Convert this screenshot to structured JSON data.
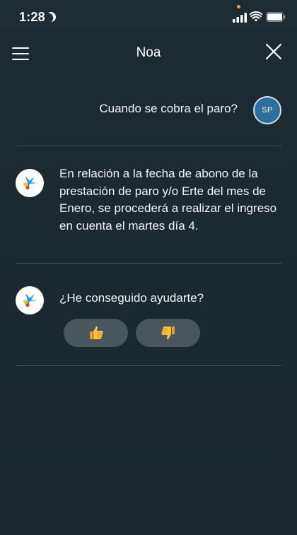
{
  "status_bar": {
    "time": "1:28"
  },
  "header": {
    "title": "Noa"
  },
  "conversation": {
    "user_message": "Cuando se cobra el paro?",
    "user_avatar_initials": "SP",
    "bot_answer": "En relación a la fecha de abono de la prestación de paro y/o Erte del mes de Enero, se procederá a realizar el ingreso en cuenta el martes día 4.",
    "bot_question": "¿He conseguido ayudarte?"
  },
  "feedback": {
    "positive_icon": "thumbs-up-icon",
    "negative_icon": "thumbs-down-icon"
  },
  "colors": {
    "background": "#1e2a32",
    "divider": "#45525b",
    "avatar": "#2c6e9e",
    "feedback_button": "#4a565e",
    "logo_blue": "#1a9be0",
    "logo_red": "#e03c31",
    "logo_yellow": "#f7c600"
  }
}
